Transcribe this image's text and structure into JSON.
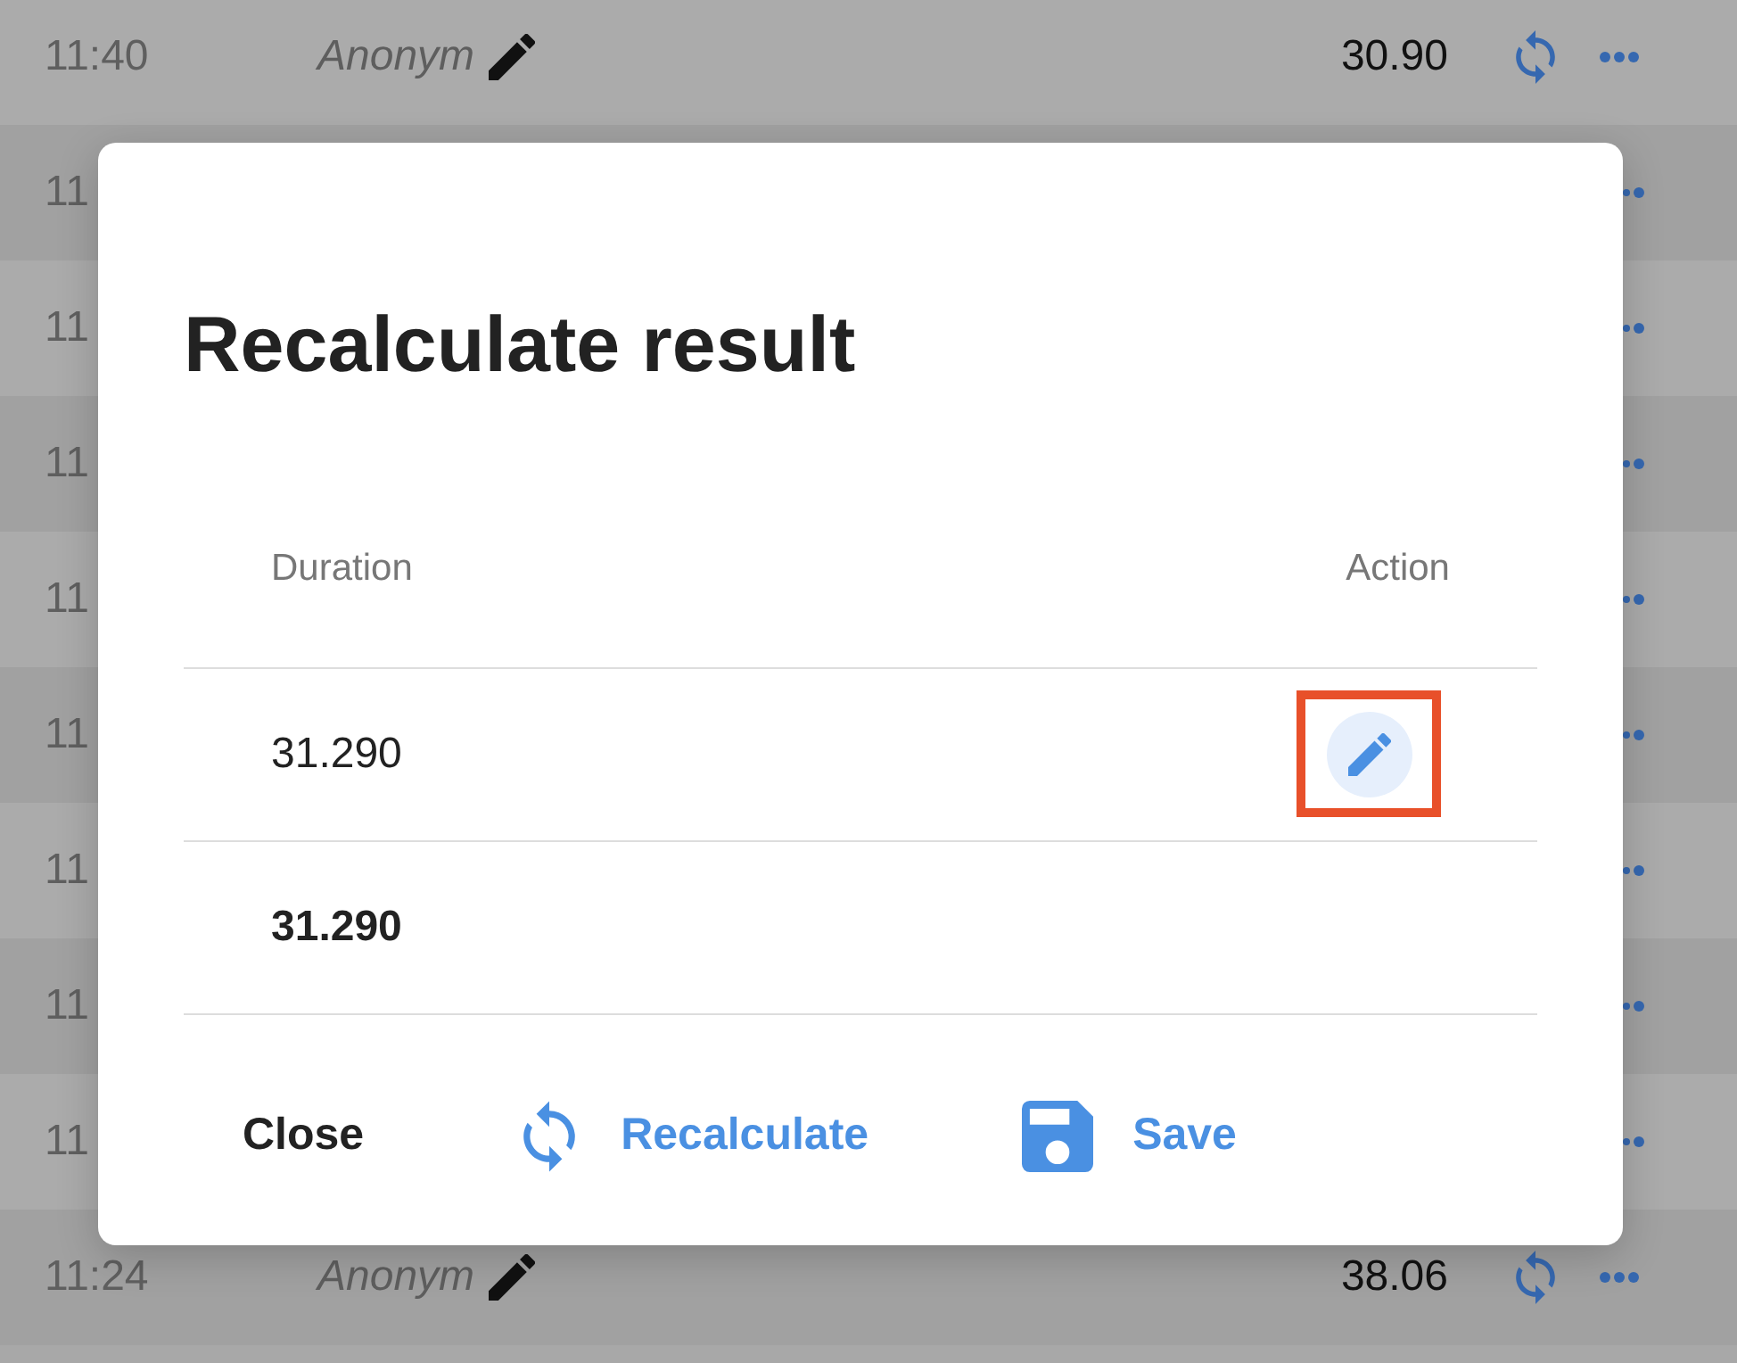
{
  "list": {
    "rows": [
      {
        "kind": "full",
        "time": "11:40",
        "name": "Anonym",
        "amount": "30.90"
      },
      {
        "kind": "covered",
        "time": "11"
      },
      {
        "kind": "covered",
        "time": "11"
      },
      {
        "kind": "covered",
        "time": "11"
      },
      {
        "kind": "covered",
        "time": "11"
      },
      {
        "kind": "covered",
        "time": "11"
      },
      {
        "kind": "covered",
        "time": "11"
      },
      {
        "kind": "covered",
        "time": "11"
      },
      {
        "kind": "covered",
        "time": "11"
      },
      {
        "kind": "full",
        "time": "11:24",
        "name": "Anonym",
        "amount": "38.06"
      }
    ]
  },
  "dialog": {
    "title": "Recalculate result",
    "columns": [
      "Duration",
      "Action"
    ],
    "rows": [
      {
        "kind": "entry",
        "duration": "31.290",
        "highlighted": true
      },
      {
        "kind": "total",
        "duration": "31.290"
      }
    ],
    "buttons": [
      {
        "kind": "plain",
        "label": "Close"
      },
      {
        "kind": "recalculate",
        "label": "Recalculate"
      },
      {
        "kind": "save",
        "label": "Save"
      }
    ]
  }
}
